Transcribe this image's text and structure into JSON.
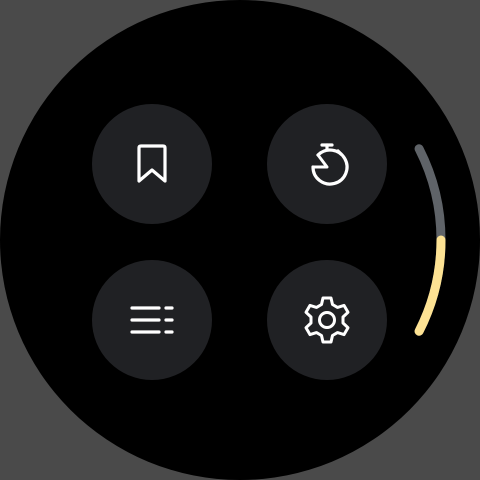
{
  "tiles": [
    {
      "name": "bookmarks",
      "icon": "bookmark-icon"
    },
    {
      "name": "timer",
      "icon": "stopwatch-icon"
    },
    {
      "name": "list",
      "icon": "list-icon"
    },
    {
      "name": "settings",
      "icon": "gear-icon"
    }
  ],
  "scroll": {
    "position_fraction": 0.5,
    "thumb_fraction": 0.5
  },
  "colors": {
    "background": "#000000",
    "tile": "#202124",
    "icon": "#ffffff",
    "scroll_track": "#5f6368",
    "scroll_thumb": "#fde293"
  }
}
